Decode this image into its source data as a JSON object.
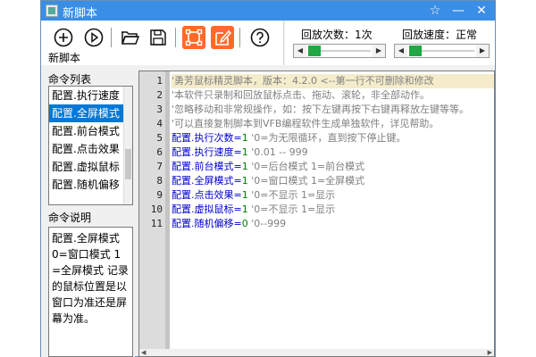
{
  "window": {
    "title": "新脚本"
  },
  "toolbar": {
    "label": "新脚本",
    "tools": [
      "add-icon",
      "play-icon",
      "open-folder-icon",
      "save-icon",
      "select-region-icon",
      "edit-icon",
      "help-icon"
    ]
  },
  "playback": {
    "count_label": "回放次数：1次",
    "speed_label": "回放速度：正常"
  },
  "command_list": {
    "title": "命令列表",
    "items": [
      "配置.执行速度",
      "配置.全屏模式",
      "配置.前台模式",
      "配置.点击效果",
      "配置.虚拟鼠标",
      "配置.随机偏移"
    ],
    "selected": "配置.全屏模式"
  },
  "command_desc": {
    "title": "命令说明",
    "text": "配置.全屏模式 0=窗口模式 1=全屏模式  记录的鼠标位置是以窗口为准还是屏幕为准。"
  },
  "editor": {
    "lines": [
      {
        "n": "1",
        "kw": "",
        "val": "",
        "comment": "'勇芳鼠标精灵脚本，版本：4.2.0  <--第一行不可删除和修改"
      },
      {
        "n": "2",
        "kw": "",
        "val": "",
        "comment": "'本软件只录制和回放鼠标点击、拖动、滚轮，非全部动作。"
      },
      {
        "n": "3",
        "kw": "",
        "val": "",
        "comment": "'忽略移动和非常规操作，如：按下左键再按下右键再释放左键等等。"
      },
      {
        "n": "4",
        "kw": "",
        "val": "",
        "comment": "'可以直接复制脚本到VFB编程软件生成单独软件，详见帮助。"
      },
      {
        "n": "5",
        "kw": "配置.执行次数=",
        "val": "1",
        "comment": "  '0=为无限循环，直到按下停止键。"
      },
      {
        "n": "6",
        "kw": "配置.执行速度=",
        "val": "1",
        "comment": "  '0.01 -- 999"
      },
      {
        "n": "7",
        "kw": "配置.前台模式=",
        "val": "1",
        "comment": "  '0=后台模式 1=前台模式"
      },
      {
        "n": "8",
        "kw": "配置.全屏模式=",
        "val": "1",
        "comment": "  '0=窗口模式 1=全屏模式"
      },
      {
        "n": "9",
        "kw": "配置.点击效果=",
        "val": "1",
        "comment": "  '0=不显示 1=显示"
      },
      {
        "n": "10",
        "kw": "配置.虚拟鼠标=",
        "val": "1",
        "comment": "  '0=不显示 1=显示"
      },
      {
        "n": "11",
        "kw": "配置.随机偏移=",
        "val": "0",
        "comment": "  '0--999"
      }
    ]
  }
}
